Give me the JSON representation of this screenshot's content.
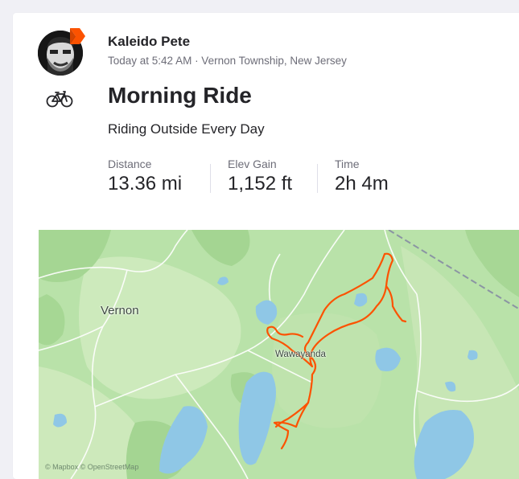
{
  "activity": {
    "athlete_name": "Kaleido Pete",
    "meta": "Today at 5:42 AM · Vernon Township, New Jersey",
    "title": "Morning Ride",
    "description": "Riding Outside Every Day",
    "sport_icon": "bike-icon"
  },
  "stats": [
    {
      "label": "Distance",
      "value": "13.36 mi"
    },
    {
      "label": "Elev Gain",
      "value": "1,152 ft"
    },
    {
      "label": "Time",
      "value": "2h 4m"
    }
  ],
  "map": {
    "labels": {
      "town1": "Vernon",
      "town2": "Wawayanda"
    },
    "attribution": "© Mapbox © OpenStreetMap",
    "route_color": "#fc5200"
  }
}
